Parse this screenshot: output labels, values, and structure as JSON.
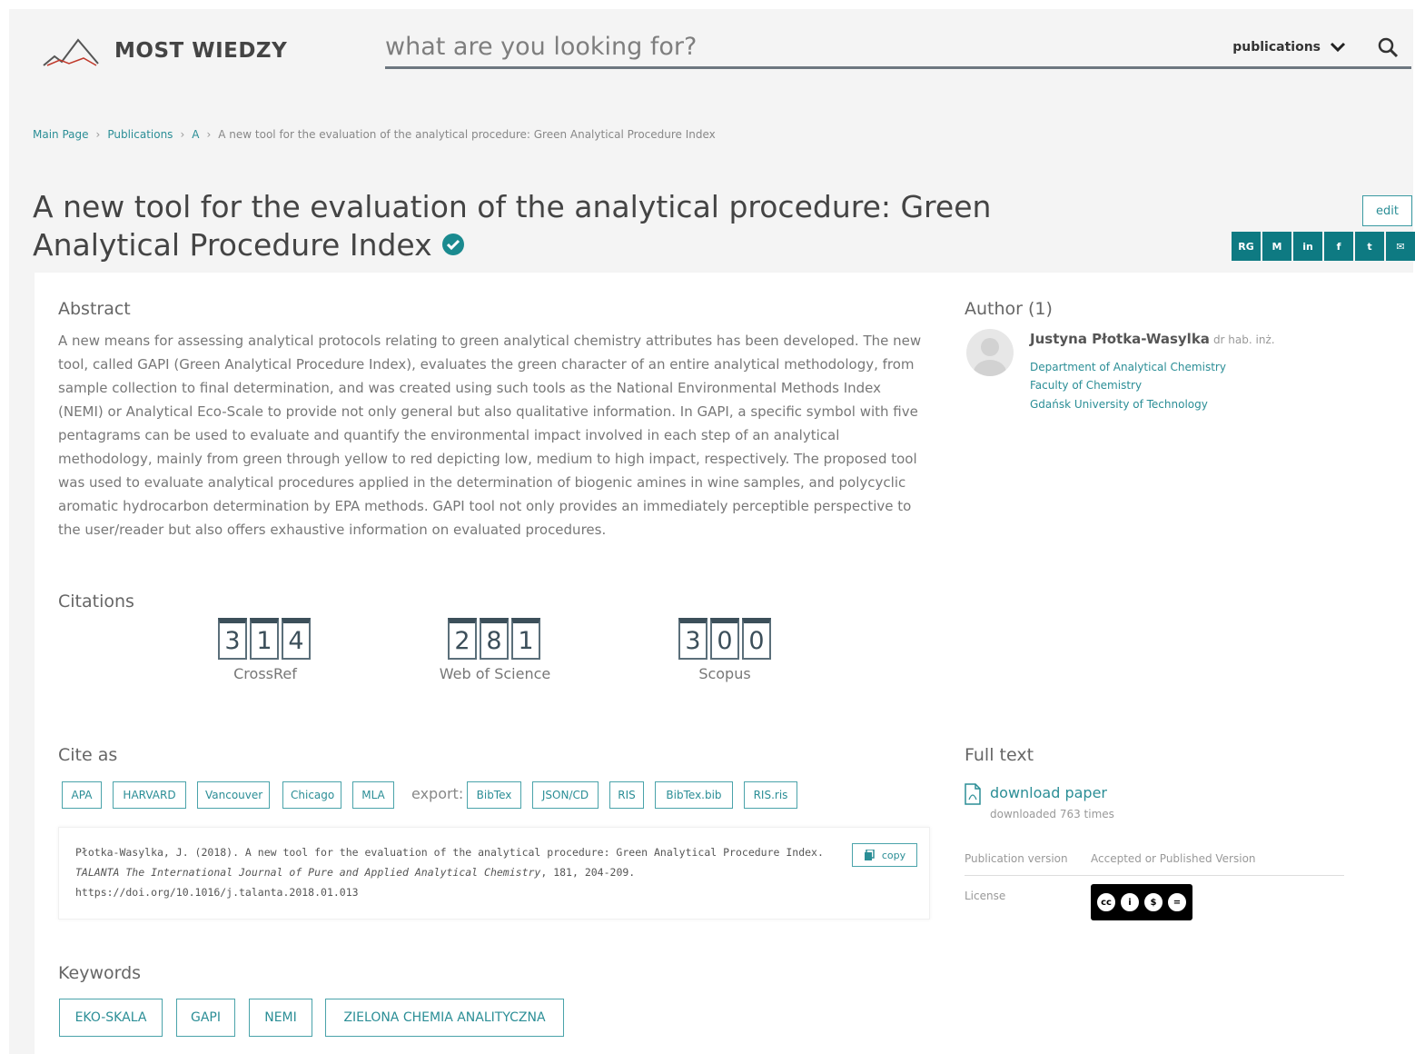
{
  "header": {
    "logo_text": "MOST WIEDZY",
    "search_placeholder": "what are you looking for?",
    "search_scope": "publications"
  },
  "breadcrumb": {
    "items": [
      "Main Page",
      "Publications",
      "A"
    ],
    "current": "A new tool for the evaluation of the analytical procedure: Green Analytical Procedure Index"
  },
  "title": "A new tool for the evaluation of the analytical procedure: Green Analytical Procedure Index",
  "actions": {
    "edit_label": "edit",
    "share": [
      "RG",
      "M",
      "in",
      "f",
      "t",
      "✉"
    ]
  },
  "abstract": {
    "heading": "Abstract",
    "text": "A new means for assessing analytical protocols relating to green analytical chemistry attributes has been developed. The new tool, called GAPI (Green Analytical Procedure Index), evaluates the green character of an entire analytical methodology, from sample collection to final determination, and was created using such tools as the National Environmental Methods Index (NEMI) or Analytical Eco-Scale to provide not only general but also qualitative information. In GAPI, a specific symbol with five pentagrams can be used to evaluate and quantify the environmental impact involved in each step of an analytical methodology, mainly from green through yellow to red depicting low, medium to high impact, respectively. The proposed tool was used to evaluate analytical procedures applied in the determination of biogenic amines in wine samples, and polycyclic aromatic hydrocarbon determination by EPA methods. GAPI tool not only provides an immediately perceptible perspective to the user/reader but also offers exhaustive information on evaluated procedures."
  },
  "authors": {
    "heading": "Author (1)",
    "name": "Justyna Płotka-Wasylka",
    "degree": "dr hab. inż.",
    "department": "Department of Analytical Chemistry",
    "faculty": "Faculty of Chemistry",
    "university": "Gdańsk University of Technology"
  },
  "citations": {
    "heading": "Citations",
    "counters": [
      {
        "label": "CrossRef",
        "digits": [
          "3",
          "1",
          "4"
        ],
        "value": 314
      },
      {
        "label": "Web of Science",
        "digits": [
          "2",
          "8",
          "1"
        ],
        "value": 281
      },
      {
        "label": "Scopus",
        "digits": [
          "3",
          "0",
          "0"
        ],
        "value": 300
      }
    ]
  },
  "cite_as": {
    "heading": "Cite as",
    "formats": [
      "APA",
      "HARVARD",
      "Vancouver",
      "Chicago",
      "MLA"
    ],
    "export_label": "export:",
    "export_formats": [
      "BibTex",
      "JSON/CD",
      "RIS",
      "BibTex.bib",
      "RIS.ris"
    ],
    "citation_plain": "Płotka-Wasylka, J. (2018). A new tool for the evaluation of the analytical procedure: Green Analytical Procedure Index.",
    "citation_journal": "TALANTA The International Journal of Pure and Applied Analytical Chemistry",
    "citation_rest": ", 181, 204-209. https://doi.org/10.1016/j.talanta.2018.01.013",
    "copy_label": "copy"
  },
  "full_text": {
    "heading": "Full text",
    "download_label": "download paper",
    "downloaded_label": "downloaded 763 times",
    "publication_version_label": "Publication version",
    "publication_version_value": "Accepted or Published Version",
    "license_label": "License"
  },
  "keywords": {
    "heading": "Keywords",
    "items": [
      "EKO-SKALA",
      "GAPI",
      "NEMI",
      "ZIELONA CHEMIA ANALITYCZNA"
    ]
  },
  "colors": {
    "accent": "#2b8e96",
    "share_bg": "#0e7a82",
    "verified": "#1a8a8f"
  }
}
